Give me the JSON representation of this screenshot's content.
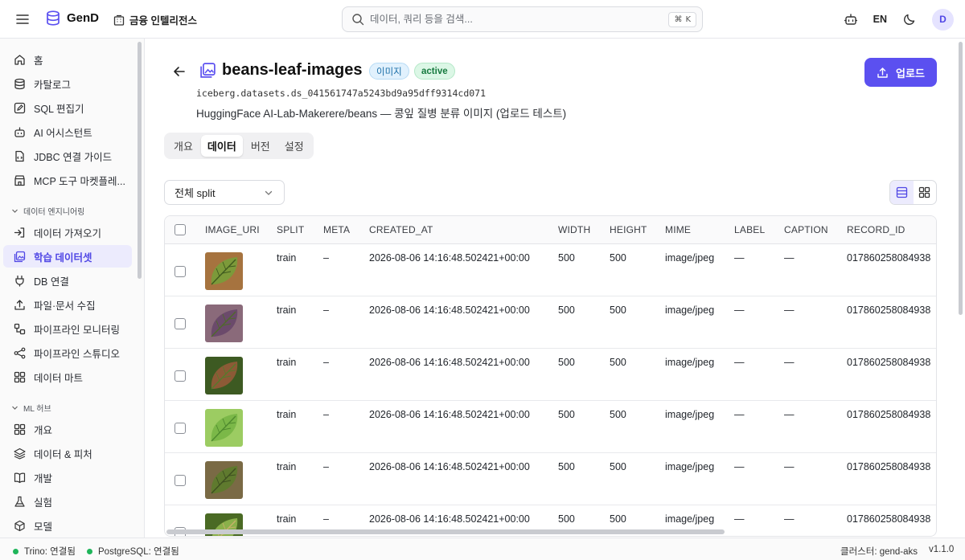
{
  "app": {
    "name": "GenD",
    "workspace": "금융 인텔리전스"
  },
  "search": {
    "placeholder": "데이터, 쿼리 등을 검색...",
    "shortcut_symbol": "⌘",
    "shortcut_key": "K"
  },
  "topbar": {
    "lang": "EN",
    "avatar": "D"
  },
  "sidebar": {
    "items": [
      {
        "label": "홈",
        "icon": "home-icon"
      },
      {
        "label": "카탈로그",
        "icon": "database-icon"
      },
      {
        "label": "SQL 편집기",
        "icon": "edit-icon"
      },
      {
        "label": "AI 어시스턴트",
        "icon": "bot-icon"
      },
      {
        "label": "JDBC 연결 가이드",
        "icon": "file-code-icon"
      },
      {
        "label": "MCP 도구 마켓플레...",
        "icon": "store-icon"
      }
    ],
    "section_data_eng": "데이터 엔지니어링",
    "data_eng_items": [
      {
        "label": "데이터 가져오기",
        "icon": "import-icon"
      },
      {
        "label": "학습 데이터셋",
        "icon": "image-dataset-icon",
        "active": true
      },
      {
        "label": "DB 연결",
        "icon": "plug-icon"
      },
      {
        "label": "파일·문서 수집",
        "icon": "upload-icon"
      },
      {
        "label": "파이프라인 모니터링",
        "icon": "pipeline-icon"
      },
      {
        "label": "파이프라인 스튜디오",
        "icon": "workflow-icon"
      },
      {
        "label": "데이터 마트",
        "icon": "grid-icon"
      }
    ],
    "section_ml": "ML 허브",
    "ml_items": [
      {
        "label": "개요",
        "icon": "grid-icon"
      },
      {
        "label": "데이터 & 피처",
        "icon": "layers-icon"
      },
      {
        "label": "개발",
        "icon": "book-icon"
      },
      {
        "label": "실험",
        "icon": "flask-icon"
      },
      {
        "label": "모델",
        "icon": "cube-icon"
      }
    ]
  },
  "dataset": {
    "title": "beans-leaf-images",
    "type_badge": "이미지",
    "status_badge": "active",
    "fqn": "iceberg.datasets.ds_041561747a5243bd9a95dff9314cd071",
    "description": "HuggingFace AI-Lab-Makerere/beans — 콩잎 질병 분류 이미지 (업로드 테스트)",
    "upload_label": "업로드"
  },
  "tabs": [
    "개요",
    "데이터",
    "버전",
    "설정"
  ],
  "active_tab": "데이터",
  "split_filter": {
    "selected": "전체 split"
  },
  "table": {
    "columns": [
      "IMAGE_URI",
      "SPLIT",
      "META",
      "CREATED_AT",
      "WIDTH",
      "HEIGHT",
      "MIME",
      "LABEL",
      "CAPTION",
      "RECORD_ID"
    ],
    "rows": [
      {
        "split": "train",
        "meta": "–",
        "created_at": "2026-08-06 14:16:48.502421+00:00",
        "width": "500",
        "height": "500",
        "mime": "image/jpeg",
        "label": "—",
        "caption": "—",
        "record_id": "017860258084938",
        "colors": [
          "#7c9a3a",
          "#3f5a1e",
          "#a6733f"
        ]
      },
      {
        "split": "train",
        "meta": "–",
        "created_at": "2026-08-06 14:16:48.502421+00:00",
        "width": "500",
        "height": "500",
        "mime": "image/jpeg",
        "label": "—",
        "caption": "—",
        "record_id": "017860258084938",
        "colors": [
          "#6b4a6b",
          "#4f6a2a",
          "#8a6a7a"
        ]
      },
      {
        "split": "train",
        "meta": "–",
        "created_at": "2026-08-06 14:16:48.502421+00:00",
        "width": "500",
        "height": "500",
        "mime": "image/jpeg",
        "label": "—",
        "caption": "—",
        "record_id": "017860258084938",
        "colors": [
          "#8c5a36",
          "#577a2c",
          "#3d5a22"
        ]
      },
      {
        "split": "train",
        "meta": "–",
        "created_at": "2026-08-06 14:16:48.502421+00:00",
        "width": "500",
        "height": "500",
        "mime": "image/jpeg",
        "label": "—",
        "caption": "—",
        "record_id": "017860258084938",
        "colors": [
          "#7bb848",
          "#4e8a2e",
          "#9ccc62"
        ]
      },
      {
        "split": "train",
        "meta": "–",
        "created_at": "2026-08-06 14:16:48.502421+00:00",
        "width": "500",
        "height": "500",
        "mime": "image/jpeg",
        "label": "—",
        "caption": "—",
        "record_id": "017860258084938",
        "colors": [
          "#5f7a2e",
          "#3e4f20",
          "#7a6a45"
        ]
      },
      {
        "split": "train",
        "meta": "–",
        "created_at": "2026-08-06 14:16:48.502421+00:00",
        "width": "500",
        "height": "500",
        "mime": "image/jpeg",
        "label": "—",
        "caption": "—",
        "record_id": "017860258084938",
        "colors": [
          "#8ab04a",
          "#c8b06a",
          "#4a6a24"
        ]
      }
    ]
  },
  "statusbar": {
    "trino": "Trino: 연결됨",
    "postgres": "PostgreSQL: 연결됨",
    "cluster": "클러스터: gend-aks",
    "version": "v1.1.0"
  },
  "colors": {
    "accent": "#5b50f0",
    "status_ok": "#1fb55a"
  }
}
